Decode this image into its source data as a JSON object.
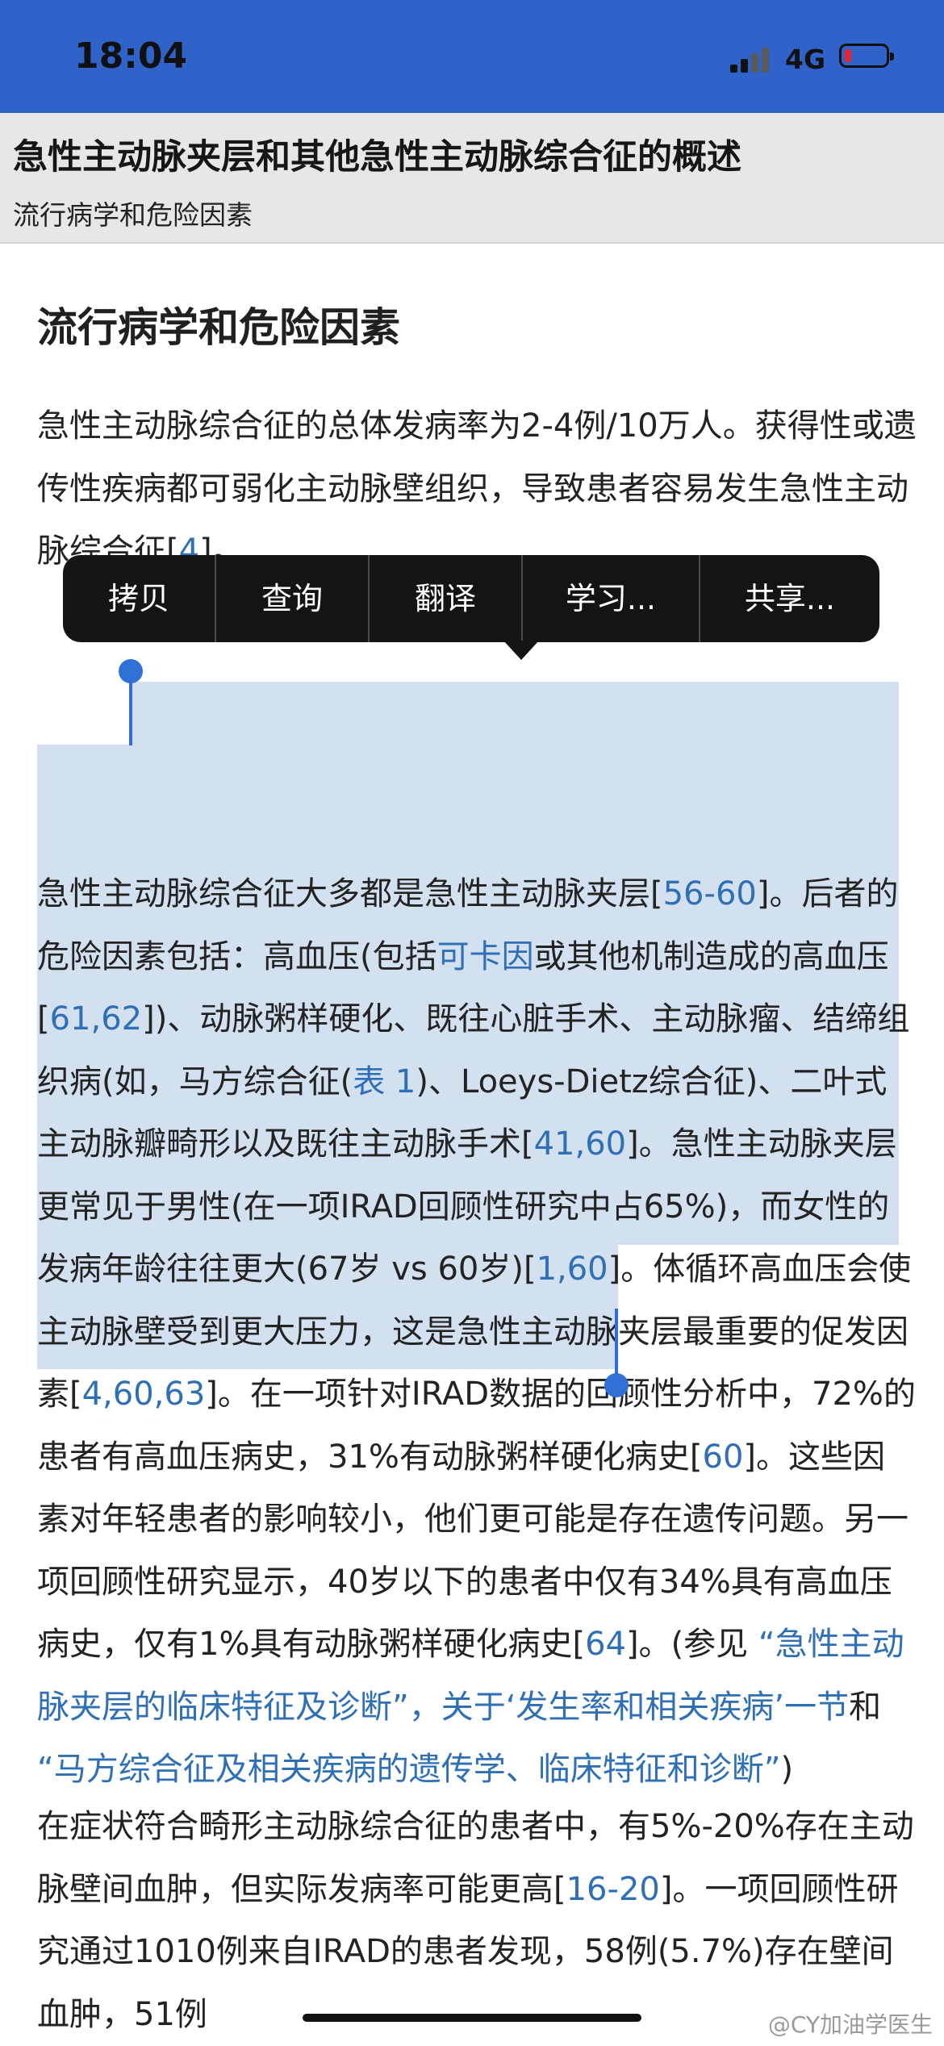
{
  "status_bar": {
    "time": "18:04",
    "network": "4G"
  },
  "header": {
    "title": "急性主动脉夹层和其他急性主动脉综合征的概述",
    "subtitle": "流行病学和危险因素"
  },
  "article": {
    "heading": "流行病学和危险因素",
    "p1": {
      "text": "急性主动脉综合征的总体发病率为2-4例/10万人。获得性或遗传性疾病都可弱化主动脉壁组织，导致患者容易发生急性主动脉综合征[",
      "ref1": "4",
      "end": "]。"
    },
    "p2": {
      "s1": "急性主动脉综合征大多都是急性主动脉夹层[",
      "r1": "56-60",
      "s2": "]。后者的危险因素包括：高血压(包括",
      "r2": "可卡因",
      "s3": "或其他机制造成的高血压[",
      "r3": "61,62",
      "s4": "])、动脉粥样硬化、既往心脏手术、主动脉瘤、结缔组织病(如，马方综合征(",
      "r4": "表 1",
      "s5": ")、Loeys-Dietz综合征)、二叶式主动脉瓣畸形以及既往主动脉手术[",
      "r5": "41,60",
      "s6": "]。急性主动脉夹层更常见于男性(在一项IRAD回顾性研究中占65%)，而女性的发病年龄往往更大(67岁 vs 60岁)[",
      "r6": "1,60",
      "s7": "]。体循环高血压会使主动脉壁受到更大压力，这是急性主动脉夹层最重要的促发因素[",
      "r7": "4,60,63",
      "s8": "]。在一项针对IRAD数据的回顾性分析中，72%的患者有高血压病史，31%有动脉粥样硬化病史[",
      "r8": "60",
      "s9": "]。这些因素对年轻患者的影响较小，他们更可能是存在遗传问题。另一项回顾性研究显示，40岁以下的患者中仅有34%具有高血压病史，仅有1%具有动脉粥样硬化病史[",
      "r9": "64",
      "s10": "]。(参见 ",
      "r10": "“急性主动脉夹层的临床特征及诊断”，关于‘发生率和相关疾病’一节",
      "s11": "和 ",
      "r11": "“马方综合征及相关疾病的遗传学、临床特征和诊断”",
      "s12": ")"
    },
    "p3": {
      "s1": "在症状符合畸形主动脉综合征的患者中，有5%-20%存在主动脉壁间血肿，但实际发病率可能更高[",
      "r1": "16-20",
      "s2": "]。一项回顾性研究通过1010例来自IRAD的患者发现，58例(5.7%)存在壁间血肿，51例"
    }
  },
  "context_menu": {
    "items": [
      "拷贝",
      "查询",
      "翻译",
      "学习...",
      "共享..."
    ]
  },
  "watermark": "@CY加油学医生"
}
